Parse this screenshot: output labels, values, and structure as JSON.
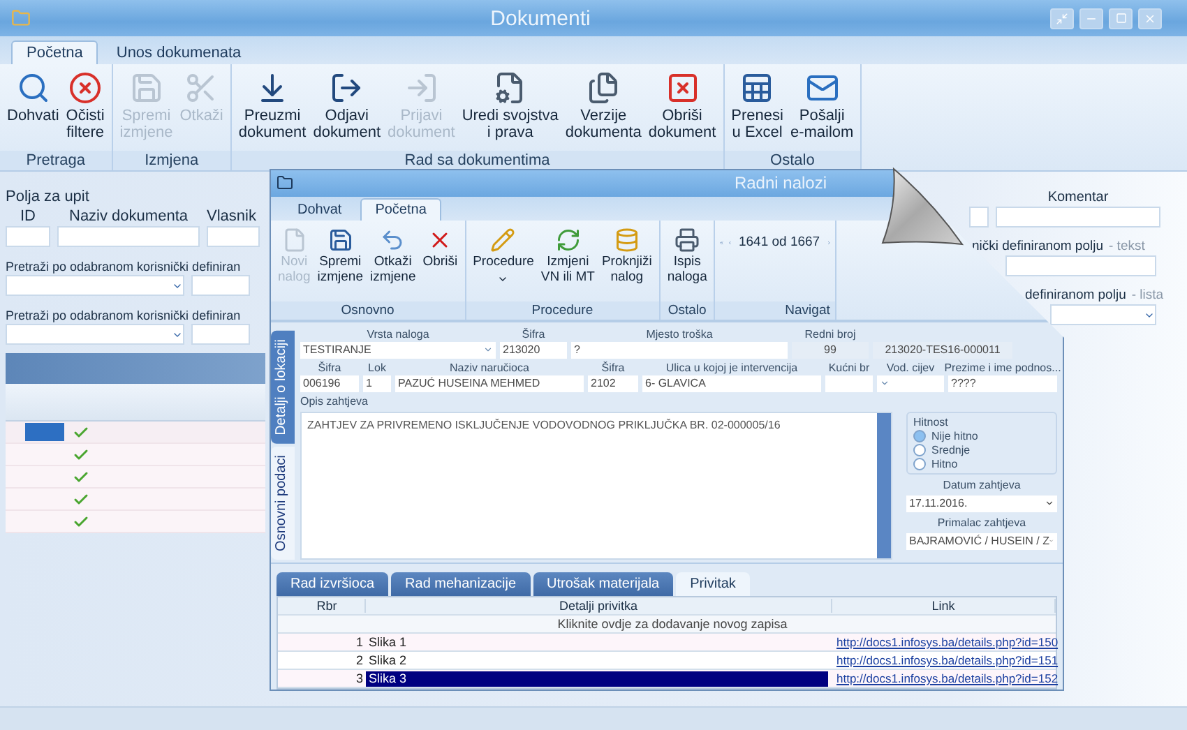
{
  "window": {
    "title": "Dokumenti"
  },
  "tabs": [
    {
      "label": "Početna",
      "selected": true
    },
    {
      "label": "Unos dokumenata",
      "selected": false
    }
  ],
  "ribbon_groups": [
    {
      "label": "Pretraga",
      "buttons": [
        {
          "label": "Dohvati",
          "disabled": false
        },
        {
          "label": "Očisti\nfiltere",
          "disabled": false
        }
      ]
    },
    {
      "label": "Izmjena",
      "buttons": [
        {
          "label": "Spremi\nizmjene",
          "disabled": true
        },
        {
          "label": "Otkaži",
          "disabled": true
        }
      ]
    },
    {
      "label": "Rad sa dokumentima",
      "buttons": [
        {
          "label": "Preuzmi\ndokument",
          "disabled": false
        },
        {
          "label": "Odjavi\ndokument",
          "disabled": false
        },
        {
          "label": "Prijavi\ndokument",
          "disabled": true
        },
        {
          "label": "Uredi svojstva\ni prava",
          "disabled": false
        },
        {
          "label": "Verzije\ndokumenta",
          "disabled": false
        },
        {
          "label": "Obriši\ndokument",
          "disabled": false
        }
      ]
    },
    {
      "label": "Ostalo",
      "buttons": [
        {
          "label": "Prenesi\nu Excel",
          "disabled": false
        },
        {
          "label": "Pošalji\ne-mailom",
          "disabled": false
        }
      ]
    }
  ],
  "query": {
    "title": "Polja za upit",
    "fields": [
      {
        "label": "ID"
      },
      {
        "label": "Naziv dokumenta"
      },
      {
        "label": "Vlasnik"
      }
    ],
    "comment_label": "Komentar",
    "filters": [
      {
        "label_left": "Pretraži po odabranom korisnički definiran",
        "label_right": "nički definiranom polju",
        "suffix": "- tekst",
        "kind": "text"
      },
      {
        "label_left": "Pretraži po odabranom korisnički definiran",
        "label_right": "definiranom polju",
        "suffix": "- lista",
        "kind": "select"
      }
    ]
  },
  "documents": [
    {
      "selected": true
    },
    {
      "selected": false
    },
    {
      "selected": false
    },
    {
      "selected": false
    },
    {
      "selected": false
    }
  ],
  "inner_window": {
    "title": "Radni nalozi",
    "tabs": [
      {
        "label": "Dohvat",
        "selected": false
      },
      {
        "label": "Početna",
        "selected": true
      }
    ],
    "ribbon_groups": [
      {
        "label": "Osnovno",
        "buttons": [
          {
            "label": "Novi\nnalog",
            "disabled": true
          },
          {
            "label": "Spremi\nizmjene",
            "disabled": false
          },
          {
            "label": "Otkaži\nizmjene",
            "disabled": false
          },
          {
            "label": "Obriši",
            "disabled": false
          }
        ]
      },
      {
        "label": "Procedure",
        "buttons": [
          {
            "label": "Procedure",
            "disabled": false
          },
          {
            "label": "Izmjeni\nVN ili MT",
            "disabled": false
          },
          {
            "label": "Proknjiži\nnalog",
            "disabled": false
          }
        ]
      },
      {
        "label": "Ostalo",
        "buttons": [
          {
            "label": "Ispis\nnaloga",
            "disabled": false
          }
        ]
      }
    ],
    "navigation": {
      "label": "Navigat",
      "position": "1641 od 1667"
    },
    "side_tabs": [
      {
        "label": "Detalji o lokaciji",
        "selected": true
      },
      {
        "label": "Osnovni podaci",
        "selected": false
      }
    ],
    "row_1": [
      {
        "label": "Vrsta naloga",
        "value": "TESTIRANJE",
        "kind": "select"
      },
      {
        "label": "Šifra",
        "value": "213020",
        "kind": "text"
      },
      {
        "label": "Mjesto troška",
        "value": "?",
        "kind": "text"
      },
      {
        "label": "Redni broj",
        "value": "99",
        "kind": "readonly"
      },
      {
        "value": "213020-TES16-000011",
        "kind": "readonly"
      }
    ],
    "row_2": [
      {
        "label": "Šifra",
        "value": "006196",
        "kind": "text"
      },
      {
        "label": "Lok",
        "value": "1",
        "kind": "number"
      },
      {
        "label": "Naziv naručioca",
        "value": "PAZUĆ HUSEINA MEHMED",
        "kind": "text"
      },
      {
        "label": "Šifra",
        "value": "2102",
        "kind": "text"
      },
      {
        "label": "Ulica u kojoj je intervencija",
        "value": "6- GLAVICA",
        "kind": "text"
      },
      {
        "label": "Kućni br",
        "kind": "text"
      },
      {
        "label": "Vod. cijev",
        "kind": "select"
      },
      {
        "label": "Prezime i ime podnos...",
        "value": "????",
        "kind": "text"
      }
    ],
    "description": {
      "label": "Opis zahtjeva",
      "value": "ZAHTJEV ZA PRIVREMENO ISKLJUČENJE VODOVODNOG PRIKLJUČKA BR. 02-000005/16"
    },
    "urgency": {
      "label": "Hitnost",
      "options": [
        {
          "label": "Nije hitno",
          "selected": true
        },
        {
          "label": "Srednje",
          "selected": false
        },
        {
          "label": "Hitno",
          "selected": false
        }
      ]
    },
    "request_date": {
      "label": "Datum zahtjeva",
      "value": "17.11.2016."
    },
    "recipient": {
      "label": "Primalac zahtjeva",
      "value": "BAJRAMOVIĆ  / HUSEIN / Z"
    },
    "bottom_tabs": [
      {
        "label": "Rad izvršioca",
        "selected": false
      },
      {
        "label": "Rad mehanizacije",
        "selected": false
      },
      {
        "label": "Utrošak materijala",
        "selected": false
      },
      {
        "label": "Privitak",
        "selected": true
      }
    ],
    "table": {
      "columns": [
        "Rbr",
        "Detalji privitka",
        "Link"
      ],
      "new_row_hint": "Kliknite ovdje za dodavanje novog zapisa",
      "rows": [
        {
          "rbr": "1",
          "details": "Slika 1",
          "link": "http://docs1.infosys.ba/details.php?id=150",
          "selected": false
        },
        {
          "rbr": "2",
          "details": "Slika 2",
          "link": "http://docs1.infosys.ba/details.php?id=151",
          "selected": false
        },
        {
          "rbr": "3",
          "details": "Slika 3",
          "link": "http://docs1.infosys.ba/details.php?id=152",
          "selected": true
        }
      ]
    }
  }
}
